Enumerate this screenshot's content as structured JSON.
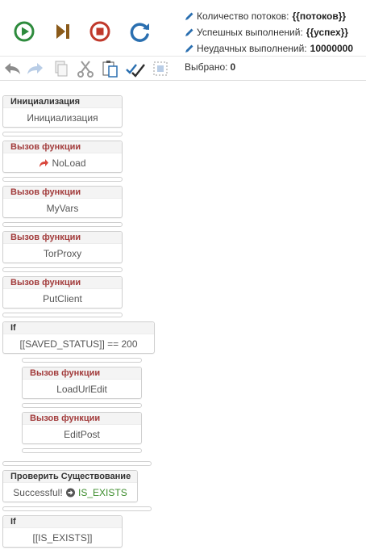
{
  "stats": {
    "threads_label": "Количество потоков:",
    "threads_value": "{{потоков}}",
    "success_label": "Успешных выполнений:",
    "success_value": "{{успех}}",
    "fail_label": "Неудачных выполнений:",
    "fail_value": "10000000"
  },
  "toolbar": {
    "selected_label": "Выбрано:",
    "selected_value": "0"
  },
  "blocks": [
    {
      "header": "Инициализация",
      "body": "Инициализация"
    },
    {
      "header": "Вызов функции",
      "body": "NoLoad"
    },
    {
      "header": "Вызов функции",
      "body": "MyVars"
    },
    {
      "header": "Вызов функции",
      "body": "TorProxy"
    },
    {
      "header": "Вызов функции",
      "body": "PutClient"
    },
    {
      "header": "If",
      "body": "[[SAVED_STATUS]] == 200"
    },
    {
      "header": "Вызов функции",
      "body": "LoadUrlEdit"
    },
    {
      "header": "Вызов функции",
      "body": "EditPost"
    },
    {
      "header": "Проверить Существование",
      "body_prefix": "Successful!",
      "body_var": "IS_EXISTS"
    },
    {
      "header": "If",
      "body": "[[IS_EXISTS]]"
    }
  ],
  "colors": {
    "play": "#2e8b3d",
    "step": "#8a5a1a",
    "stop": "#c0392b",
    "refresh": "#2a6fb0",
    "function_header": "#a23b3b",
    "success_text": "#3c8c2c"
  }
}
